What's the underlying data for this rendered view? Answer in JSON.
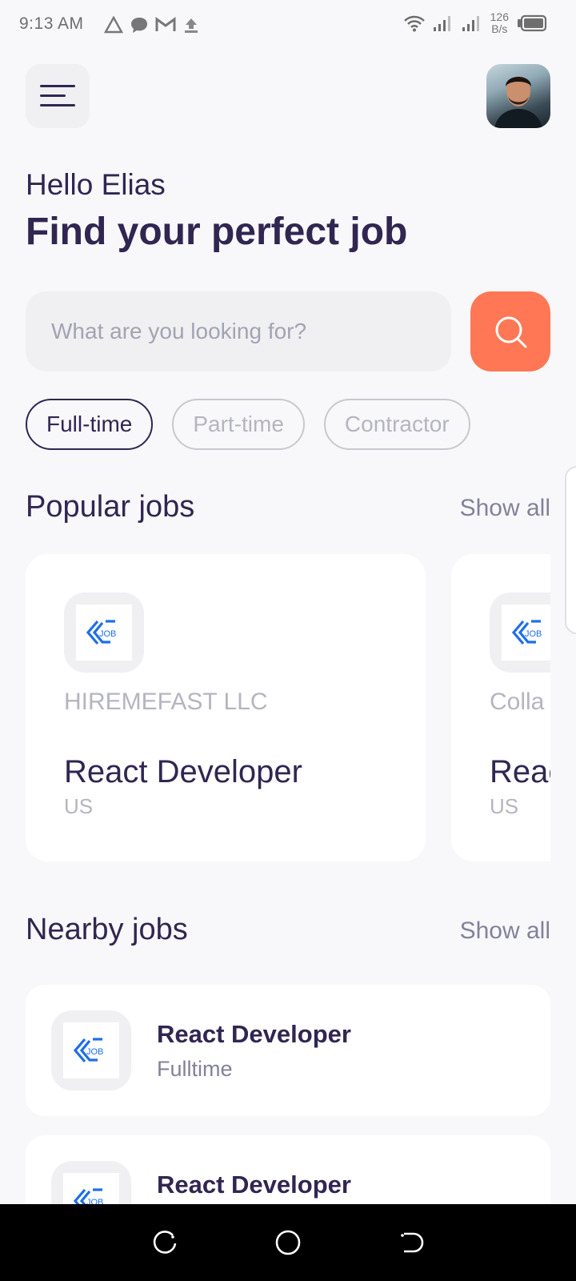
{
  "status_bar": {
    "time": "9:13 AM",
    "net_speed_value": "126",
    "net_speed_unit": "B/s",
    "notification_icons": [
      "triangle-alert-icon",
      "chat-bubble-icon",
      "gmail-icon",
      "upload-icon"
    ],
    "right_icons": [
      "wifi-icon",
      "signal-icon",
      "signal-icon",
      "battery-icon"
    ]
  },
  "header": {
    "menu_icon": "menu-icon",
    "avatar_alt": "profile-avatar"
  },
  "greeting": "Hello Elias",
  "headline": "Find your perfect job",
  "search": {
    "placeholder": "What are you looking for?",
    "value": "",
    "button_icon": "search-icon"
  },
  "job_types": [
    {
      "label": "Full-time",
      "active": true
    },
    {
      "label": "Part-time",
      "active": false
    },
    {
      "label": "Contractor",
      "active": false
    }
  ],
  "popular": {
    "title": "Popular jobs",
    "show_all": "Show all",
    "cards": [
      {
        "company": "HIREMEFAST LLC",
        "title": "React Developer",
        "location": "US",
        "logo_text": "JOB"
      },
      {
        "company": "Colla",
        "title": "Reac",
        "location": "US",
        "logo_text": "JOB"
      }
    ]
  },
  "nearby": {
    "title": "Nearby jobs",
    "show_all": "Show all",
    "items": [
      {
        "title": "React Developer",
        "type": "Fulltime",
        "logo_text": "JOB"
      },
      {
        "title": "React Developer",
        "type": "",
        "logo_text": "JOB"
      }
    ]
  },
  "colors": {
    "primary": "#312651",
    "accent": "#FF7754",
    "gray": "#83829A",
    "light_gray": "#B5B5C0",
    "background": "#F8F8FB",
    "logo_blue": "#1E6FE8"
  },
  "nav": [
    "recents-icon",
    "home-icon",
    "back-icon"
  ]
}
